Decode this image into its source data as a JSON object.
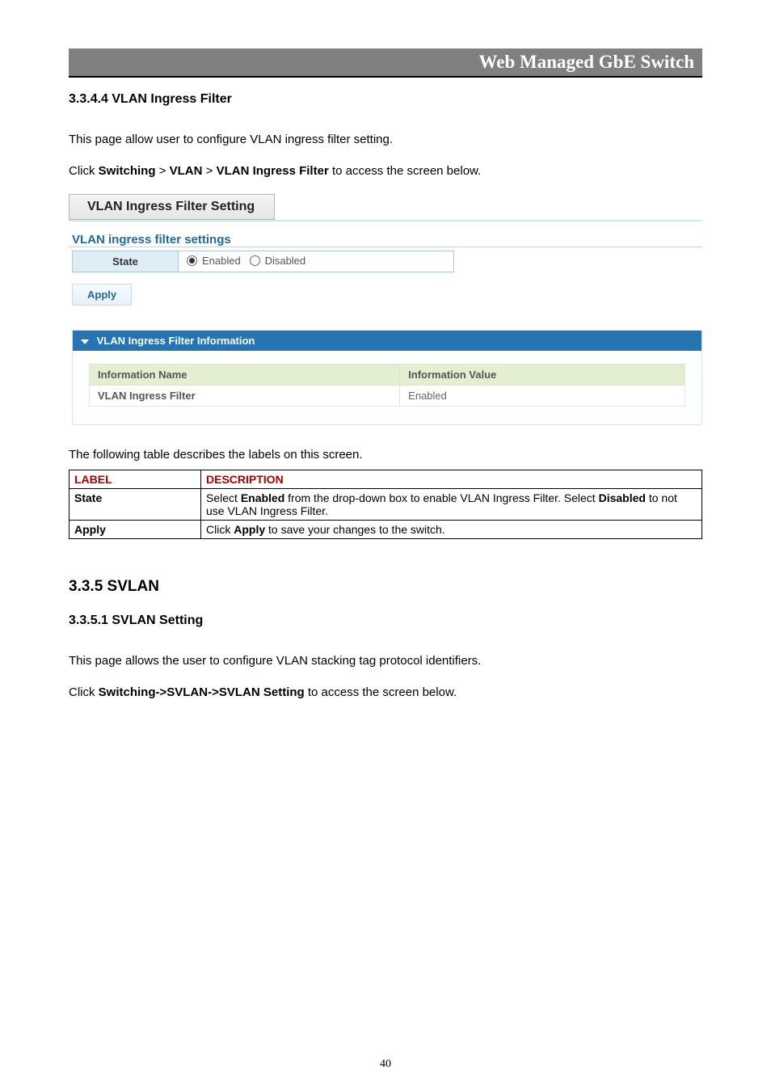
{
  "header": {
    "title": "Web Managed GbE Switch"
  },
  "section1": {
    "heading": "3.3.4.4 VLAN Ingress Filter",
    "para1": "This page allow user to configure VLAN ingress filter setting.",
    "nav_prefix": "Click ",
    "nav_switching": "Switching",
    "nav_sep1": " > ",
    "nav_vlan": "VLAN",
    "nav_sep2": " > ",
    "nav_filter": "VLAN Ingress Filter",
    "nav_suffix": " to access the screen below."
  },
  "ui": {
    "panel_title": "VLAN Ingress Filter Setting",
    "sub_title": "VLAN ingress filter settings",
    "state_label": "State",
    "enabled_label": "Enabled",
    "disabled_label": "Disabled",
    "apply_label": "Apply",
    "info_header": "VLAN Ingress Filter Information",
    "info_col1": "Information Name",
    "info_col2": "Information Value",
    "info_row_label": "VLAN Ingress Filter",
    "info_row_value": "Enabled"
  },
  "desc": {
    "intro": "The following table describes the labels on this screen.",
    "col_label": "LABEL",
    "col_desc": "DESCRIPTION",
    "rows": [
      {
        "label": "State",
        "pre1": "Select ",
        "b1": "Enabled",
        "mid1": " from the drop-down box to enable VLAN Ingress Filter. Select ",
        "b2": "Disabled",
        "post1": " to not use VLAN Ingress Filter."
      },
      {
        "label": "Apply",
        "pre1": "Click ",
        "b1": "Apply",
        "mid1": " to save your changes to the switch.",
        "b2": "",
        "post1": ""
      }
    ]
  },
  "section2": {
    "heading_big": "3.3.5 SVLAN",
    "heading": "3.3.5.1 SVLAN Setting",
    "para1": "This page allows the user to configure VLAN stacking tag protocol identifiers.",
    "nav_prefix": "Click ",
    "nav_path": "Switching->SVLAN->SVLAN Setting",
    "nav_suffix": " to access the screen below."
  },
  "page_number": "40"
}
